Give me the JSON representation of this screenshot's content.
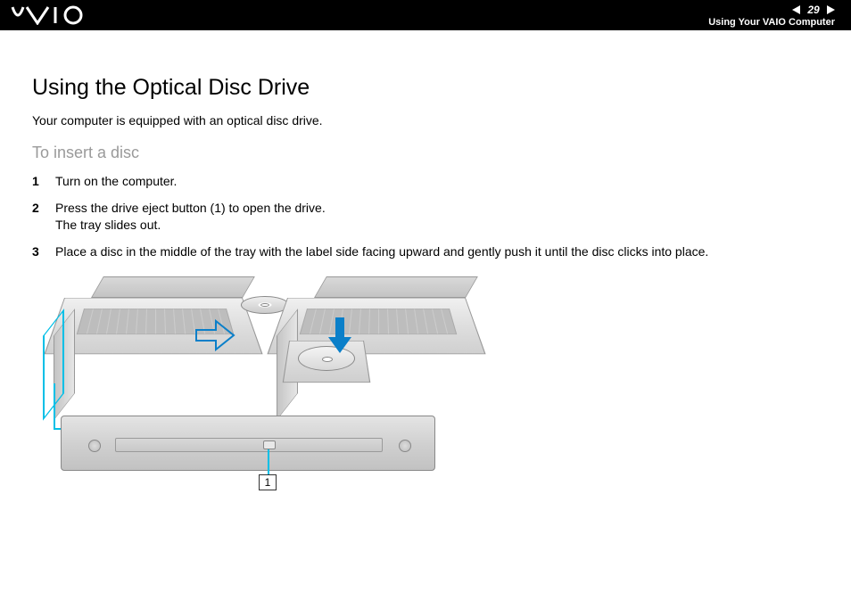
{
  "header": {
    "logo_alt": "VAIO",
    "page_number": "29",
    "section": "Using Your VAIO Computer"
  },
  "title": "Using the Optical Disc Drive",
  "intro": "Your computer is equipped with an optical disc drive.",
  "subheading": "To insert a disc",
  "steps": [
    {
      "text": "Turn on the computer."
    },
    {
      "text": "Press the drive eject button (1) to open the drive.\nThe tray slides out."
    },
    {
      "text": "Place a disc in the middle of the tray with the label side facing upward and gently push it until the disc clicks into place."
    }
  ],
  "illustration": {
    "callout_label": "1",
    "accent_color": "#00bfe6",
    "arrow_color": "#0a7fc9"
  }
}
